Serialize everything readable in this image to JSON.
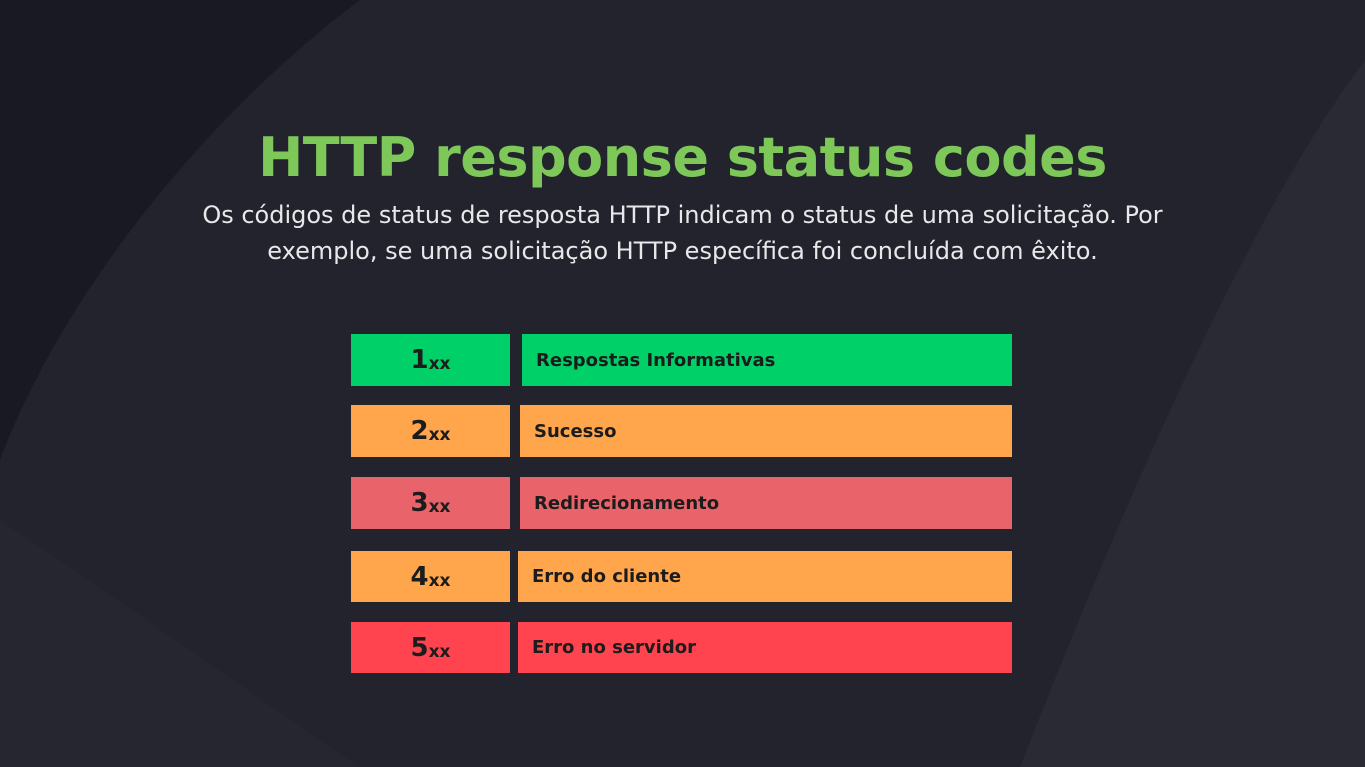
{
  "title": "HTTP response status codes",
  "subtitle": "Os códigos de status de resposta HTTP indicam o status de uma solicitação. Por exemplo, se uma solicitação HTTP específica foi concluída com êxito.",
  "colors": {
    "title": "#7ec85a",
    "background": "#1f2029",
    "informational": "#00d068",
    "success": "#ffa64d",
    "redirect": "#e8636a",
    "client_error": "#ffa64d",
    "server_error": "#ff4450"
  },
  "status_codes": [
    {
      "digit": "1",
      "suffix": "xx",
      "label": "Respostas Informativas",
      "color": "#00d068"
    },
    {
      "digit": "2",
      "suffix": "xx",
      "label": "Sucesso",
      "color": "#ffa64d"
    },
    {
      "digit": "3",
      "suffix": "xx",
      "label": "Redirecionamento",
      "color": "#e8636a"
    },
    {
      "digit": "4",
      "suffix": "xx",
      "label": "Erro do cliente",
      "color": "#ffa64d"
    },
    {
      "digit": "5",
      "suffix": "xx",
      "label": "Erro no servidor",
      "color": "#ff4450"
    }
  ]
}
